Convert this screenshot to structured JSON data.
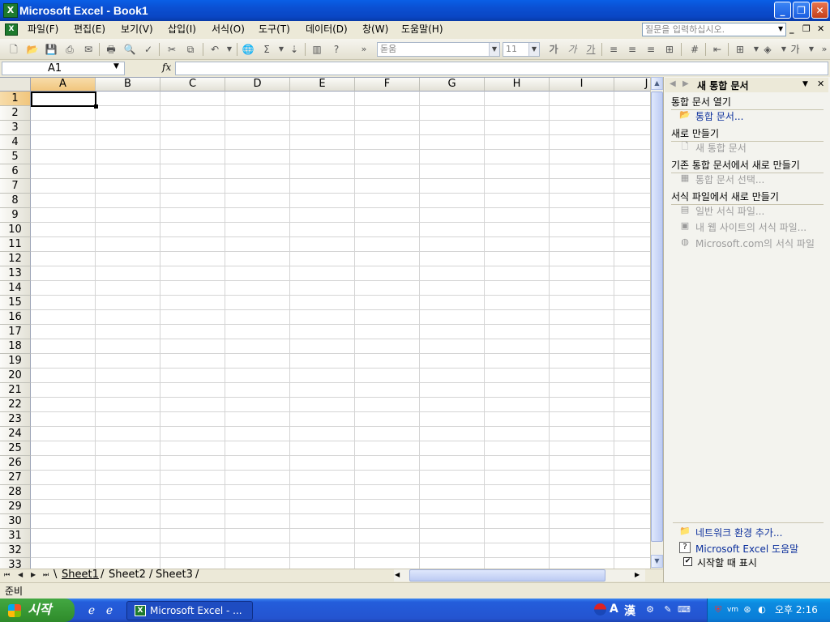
{
  "window": {
    "title": "Microsoft Excel - Book1",
    "app_icon": "X"
  },
  "menu": {
    "items": [
      "파일(F)",
      "편집(E)",
      "보기(V)",
      "삽입(I)",
      "서식(O)",
      "도구(T)",
      "데이터(D)",
      "창(W)",
      "도움말(H)"
    ],
    "help_placeholder": "질문을 입력하십시오."
  },
  "toolbar": {
    "font_name": "돋움",
    "font_size": "11",
    "bold_label": "가",
    "italic_label": "가",
    "underline_label": "가"
  },
  "formula": {
    "name_box": "A1",
    "fx_label": "fx",
    "value": ""
  },
  "grid": {
    "columns": [
      "A",
      "B",
      "C",
      "D",
      "E",
      "F",
      "G",
      "H",
      "I",
      "J"
    ],
    "rows": [
      "1",
      "2",
      "3",
      "4",
      "5",
      "6",
      "7",
      "8",
      "9",
      "10",
      "11",
      "12",
      "13",
      "14",
      "15",
      "16",
      "17",
      "18",
      "19",
      "20",
      "21",
      "22",
      "23",
      "24",
      "25",
      "26",
      "27",
      "28",
      "29",
      "30",
      "31",
      "32",
      "33"
    ],
    "selected_cell": "A1"
  },
  "sheets": {
    "tabs": [
      "Sheet1",
      "Sheet2",
      "Sheet3"
    ],
    "active": "Sheet1"
  },
  "taskpane": {
    "title": "새 통합 문서",
    "sections": [
      {
        "heading": "통합 문서 열기",
        "links": [
          {
            "label": "통합 문서...",
            "icon": "folder-open-icon",
            "enabled": true
          }
        ]
      },
      {
        "heading": "새로 만들기",
        "links": [
          {
            "label": "새 통합 문서",
            "icon": "blank-document-icon",
            "enabled": false
          }
        ]
      },
      {
        "heading": "기존 통합 문서에서 새로 만들기",
        "links": [
          {
            "label": "통합 문서 선택...",
            "icon": "workbook-select-icon",
            "enabled": false
          }
        ]
      },
      {
        "heading": "서식 파일에서 새로 만들기",
        "links": [
          {
            "label": "일반 서식 파일...",
            "icon": "template-icon",
            "enabled": false
          },
          {
            "label": "내 웹 사이트의 서식 파일...",
            "icon": "web-template-icon",
            "enabled": false
          },
          {
            "label": "Microsoft.com의 서식 파일",
            "icon": "globe-icon",
            "enabled": false
          }
        ]
      }
    ],
    "bottom_links": [
      {
        "label": "네트워크 환경 추가...",
        "icon": "network-folder-icon"
      },
      {
        "label": "Microsoft Excel 도움말",
        "icon": "help-icon"
      }
    ],
    "show_at_startup_label": "시작할 때 표시",
    "show_at_startup_checked": true
  },
  "status": {
    "text": "준비"
  },
  "taskbar": {
    "start_label": "시작",
    "task_label": "Microsoft Excel - ...",
    "clock": "오후 2:16",
    "ime_a": "A",
    "ime_han": "漢"
  }
}
